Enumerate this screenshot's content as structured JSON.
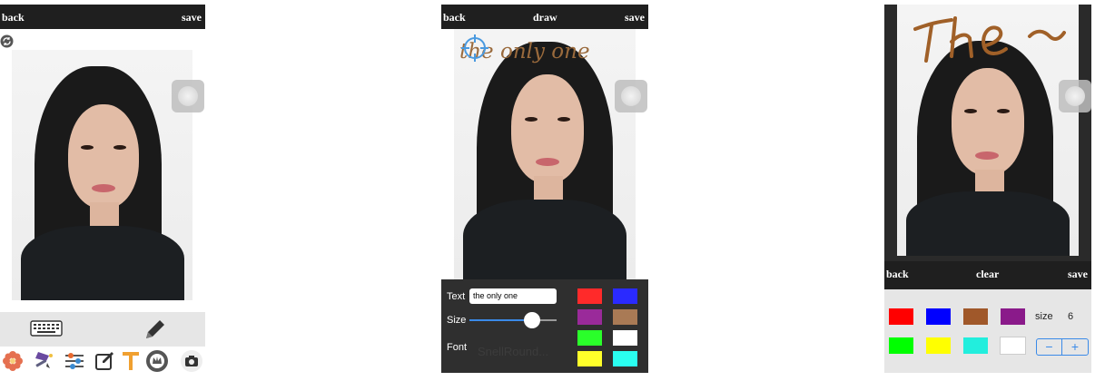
{
  "screen1": {
    "back": "back",
    "save": "save",
    "icons": [
      "refresh-icon",
      "keyboard-icon",
      "pencil-icon",
      "flower-icon",
      "magic-wand-icon",
      "sliders-icon",
      "edit-icon",
      "text-t-icon",
      "crown-badge-icon",
      "camera-icon"
    ]
  },
  "screen2": {
    "back": "back",
    "title": "draw",
    "save": "save",
    "overlay_text": "the only one",
    "text_label": "Text",
    "text_value": "the only one",
    "size_label": "Size",
    "size_level": 0.77,
    "font_label": "Font",
    "font_value": "SnellRound...",
    "colors": [
      "#ff2a2a",
      "#2a2aff",
      "#9a2a9a",
      "#a97a55",
      "#2aff2a",
      "#ffffff",
      "#ffff2a",
      "#2afff0"
    ]
  },
  "screen3": {
    "back": "back",
    "clear": "clear",
    "save": "save",
    "size_label": "size",
    "size_value": "6",
    "minus": "−",
    "plus": "+",
    "colors": [
      "#ff0000",
      "#0000ff",
      "#a0582a",
      "#8a1a8a",
      "#00ff00",
      "#ffff00",
      "#22eedd",
      "#ffffff"
    ]
  }
}
